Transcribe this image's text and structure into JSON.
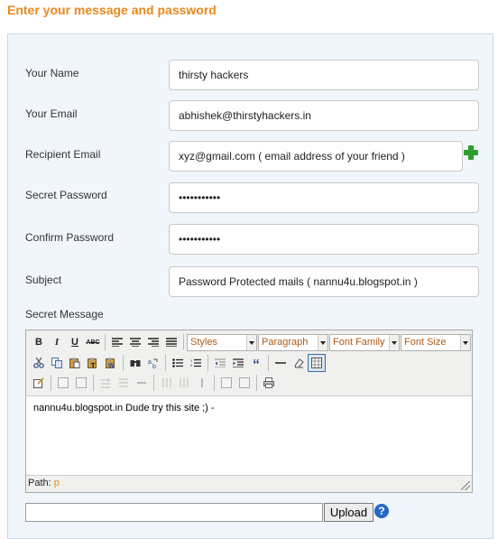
{
  "page_title": "Enter your message and password",
  "form": {
    "name_label": "Your Name",
    "name_value": "thirsty hackers",
    "email_label": "Your Email",
    "email_value": "abhishek@thirstyhackers.in",
    "recipient_label": "Recipient Email",
    "recipient_value": "xyz@gmail.com ( email address of your friend )",
    "password_label": "Secret Password",
    "password_value": "•••••••••••",
    "confirm_label": "Confirm Password",
    "confirm_value": "•••••••••••",
    "subject_label": "Subject",
    "subject_value": "Password Protected mails ( nannu4u.blogspot.in )",
    "message_label": "Secret Message"
  },
  "editor": {
    "dropdowns": {
      "styles": "Styles",
      "paragraph": "Paragraph",
      "font_family": "Font Family",
      "font_size": "Font Size"
    },
    "buttons": {
      "bold": "B",
      "italic": "I",
      "underline": "U",
      "strike": "ABC"
    },
    "content": "nannu4u.blogspot.in Dude try this site ;) -",
    "path_label": "Path:",
    "path_value": "p"
  },
  "upload": {
    "button_label": "Upload",
    "help_glyph": "?"
  },
  "colors": {
    "title": "#e8891c",
    "panel_bg": "#f0f6fc",
    "add_icon": "#2f9e2f",
    "help_icon": "#2469c4"
  }
}
